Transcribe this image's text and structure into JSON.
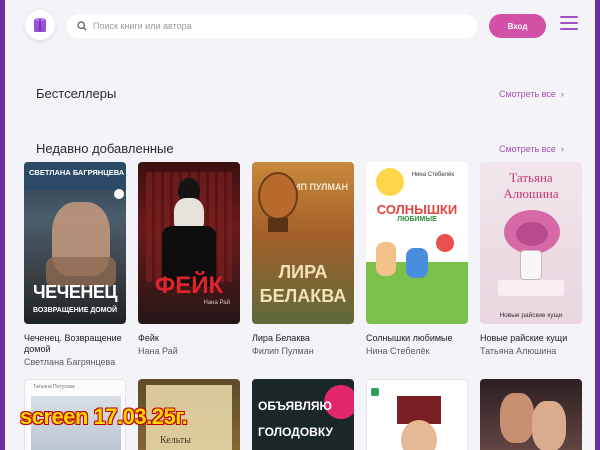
{
  "header": {
    "search_placeholder": "Поиск книги или автора",
    "login_label": "Вход"
  },
  "sections": {
    "bestsellers": {
      "title": "Бестселлеры",
      "see_all": "Смотреть все"
    },
    "recent": {
      "title": "Недавно добавленные",
      "see_all": "Смотреть все"
    }
  },
  "books": [
    {
      "title": "Чеченец. Возвращение домой",
      "author": "Светлана Багрянцева",
      "cover_author": "СВЕТЛАНА БАГРЯНЦЕВА",
      "cover_title_1": "ЧЕЧЕНЕЦ",
      "cover_title_2": "ВОЗВРАЩЕНИЕ ДОМОЙ"
    },
    {
      "title": "Фейк",
      "author": "Нана Рай",
      "cover_title": "ФЕЙК",
      "cover_author": "Нана Рай"
    },
    {
      "title": "Лира Белаква",
      "author": "Филип Пулман",
      "cover_author": "ФИЛИП ПУЛМАН",
      "cover_title_1": "ЛИРА",
      "cover_title_2": "БЕЛАКВА"
    },
    {
      "title": "Солнышки любимые",
      "author": "Нина Стебелёк",
      "cover_author": "Нина Стебелёк",
      "cover_title_1": "СОЛНЫШКИ",
      "cover_title_2": "ЛЮБИМЫЕ"
    },
    {
      "title": "Новые райские кущи",
      "author": "Татьяна Алюшина",
      "cover_author_1": "Татьяна",
      "cover_author_2": "Алюшина",
      "cover_title": "Новые райские кущи"
    }
  ],
  "row2": [
    {
      "cover_author": "Татьяна Петухова"
    },
    {
      "cover_title": "Кельты"
    },
    {
      "cover_title_1": "ОБЪЯВЛЯЮ",
      "cover_title_2": "ГОЛОДОВКУ"
    },
    {},
    {}
  ],
  "overlay": {
    "stamp": "screen 17.03.25г."
  },
  "colors": {
    "accent": "#d250a6",
    "link": "#a44fb3",
    "frame": "#6a2fa0",
    "background": "#f4f3f8"
  }
}
